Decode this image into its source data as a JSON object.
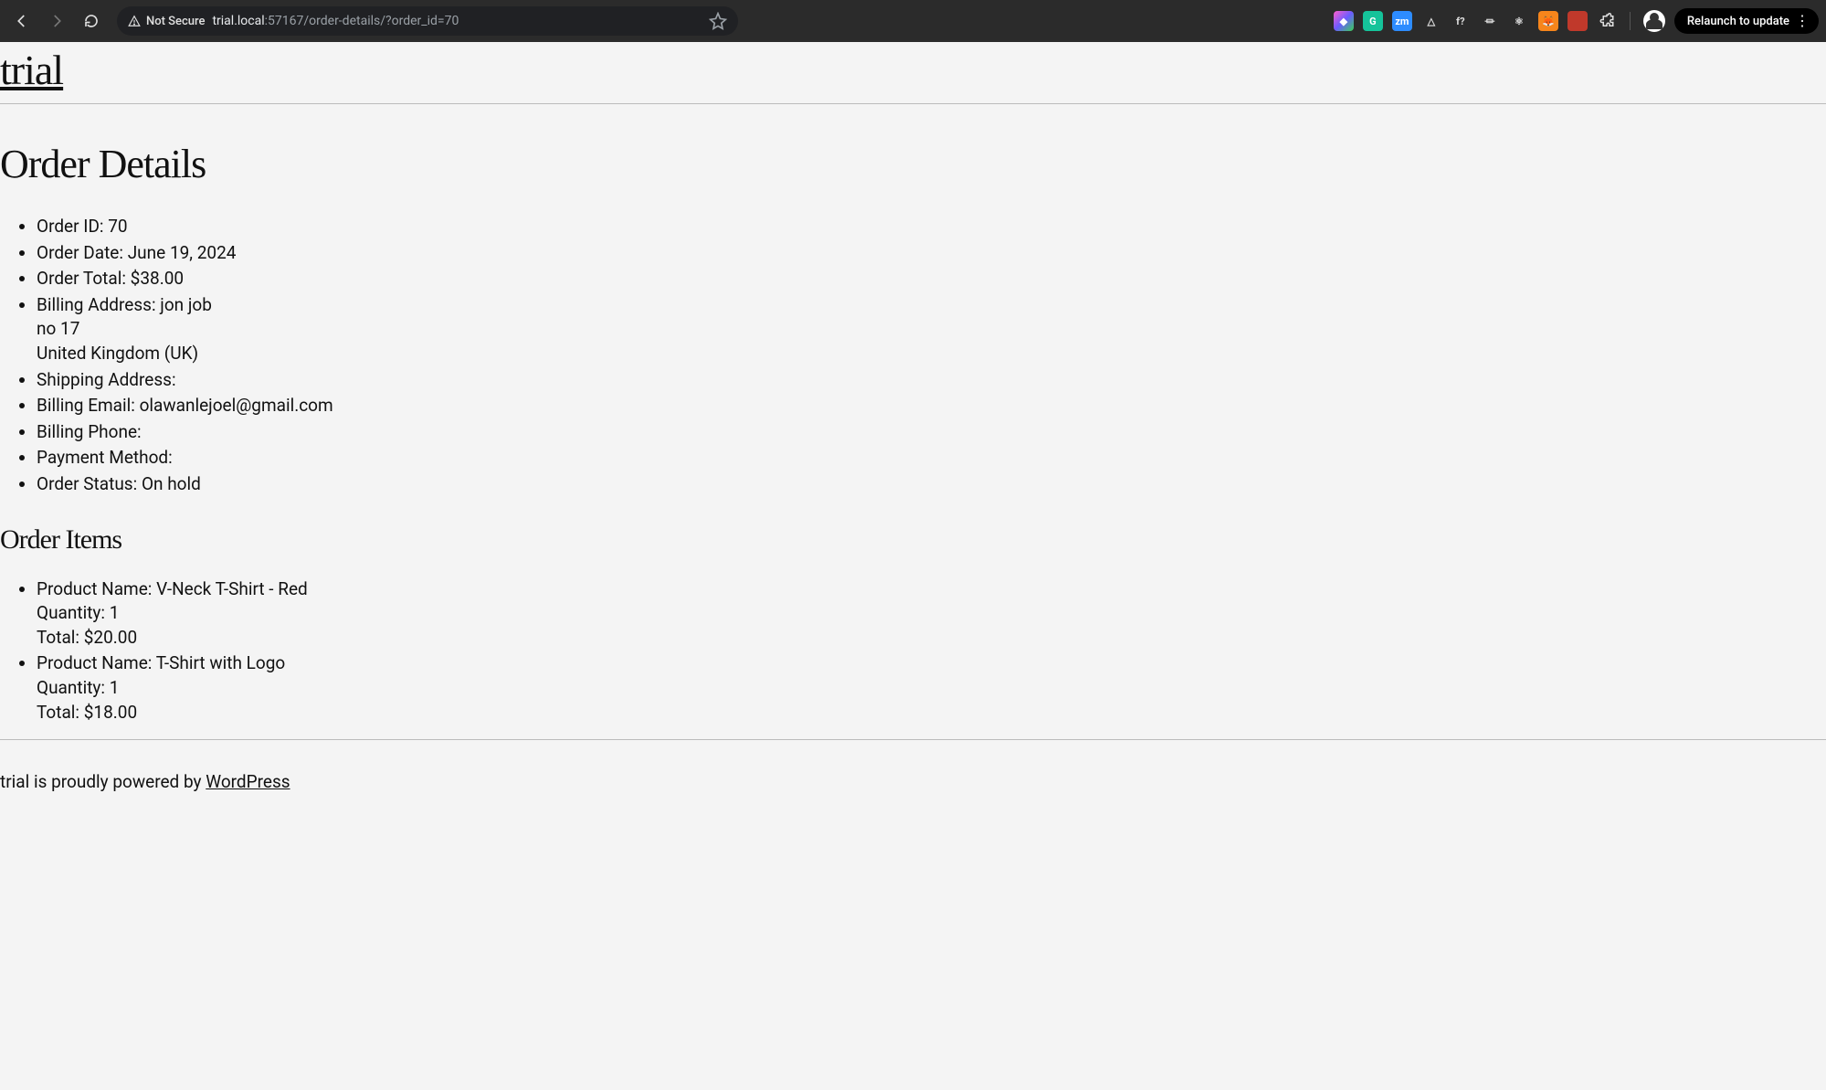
{
  "browser": {
    "not_secure_label": "Not Secure",
    "url_host": "trial.local",
    "url_port_path": ":57167/order-details/?order_id=70",
    "relaunch_label": "Relaunch to update",
    "extensions": [
      {
        "name": "extension-1",
        "bg": "linear-gradient(135deg,#ff5ecb,#6a5cff,#39d353)",
        "glyph": "◆"
      },
      {
        "name": "grammarly",
        "bg": "#15c39a",
        "glyph": "G"
      },
      {
        "name": "zoom",
        "bg": "#2d8cff",
        "glyph": "zm"
      },
      {
        "name": "google-drive",
        "bg": "transparent",
        "glyph": "△"
      },
      {
        "name": "function",
        "bg": "transparent",
        "glyph": "f?"
      },
      {
        "name": "extension-6",
        "bg": "transparent",
        "glyph": "⏛"
      },
      {
        "name": "react-devtools",
        "bg": "transparent",
        "glyph": "⚛"
      },
      {
        "name": "metamask",
        "bg": "#f6851b",
        "glyph": "🦊"
      },
      {
        "name": "extension-9",
        "bg": "#c0392b",
        "glyph": ""
      }
    ]
  },
  "site": {
    "title": "trial"
  },
  "page": {
    "heading": "Order Details",
    "labels": {
      "order_id": "Order ID:",
      "order_date": "Order Date:",
      "order_total": "Order Total:",
      "billing_address": "Billing Address:",
      "shipping_address": "Shipping Address:",
      "billing_email": "Billing Email:",
      "billing_phone": "Billing Phone:",
      "payment_method": "Payment Method:",
      "order_status": "Order Status:"
    },
    "order": {
      "id": "70",
      "date": "June 19, 2024",
      "total": "$38.00",
      "billing_address_line1": "jon job",
      "billing_address_line2": "no 17",
      "billing_address_line3": "United Kingdom (UK)",
      "shipping_address": "",
      "billing_email": "olawanlejoel@gmail.com",
      "billing_phone": "",
      "payment_method": "",
      "status": "On hold"
    },
    "items_heading": "Order Items",
    "item_labels": {
      "product_name": "Product Name:",
      "quantity": "Quantity:",
      "total": "Total:"
    },
    "items": [
      {
        "name": "V-Neck T-Shirt - Red",
        "quantity": "1",
        "total": "$20.00"
      },
      {
        "name": "T-Shirt with Logo",
        "quantity": "1",
        "total": "$18.00"
      }
    ]
  },
  "footer": {
    "prefix": "trial is proudly powered by ",
    "link_text": "WordPress"
  }
}
